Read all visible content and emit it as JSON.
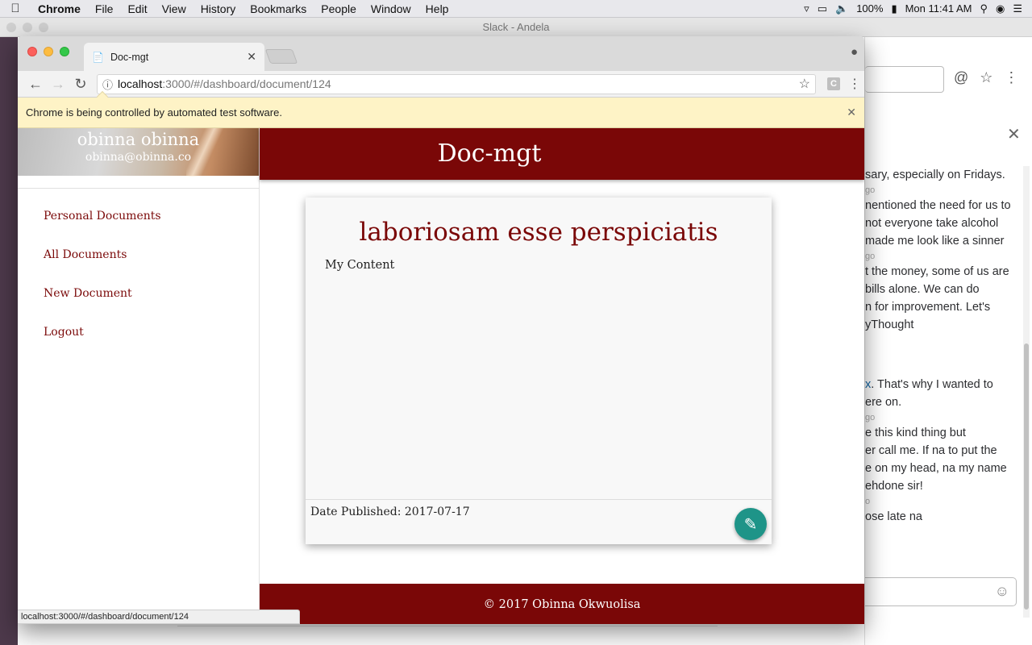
{
  "menubar": {
    "app": "Chrome",
    "items": [
      "File",
      "Edit",
      "View",
      "History",
      "Bookmarks",
      "People",
      "Window",
      "Help"
    ],
    "battery": "100%",
    "clock": "Mon 11:41 AM"
  },
  "slack": {
    "window_title": "Slack - Andela",
    "messages": [
      "sary, especially on Fridays.",
      "go",
      "nentioned the need for us to",
      "not everyone take alcohol",
      "made me look like a sinner",
      "go",
      "t the money, some of us are",
      "bills alone. We can do",
      "n for improvement. Let's",
      "yThought"
    ],
    "messages2_link": "x",
    "messages2": [
      ". That's why I wanted to",
      "ere on.",
      "go",
      "e this kind thing but",
      "er call me. If na to put the",
      "e on my head, na my name",
      "ehdone sir!",
      "o",
      "ose late na"
    ]
  },
  "browser": {
    "tab_title": "Doc-mgt",
    "url_host": "localhost",
    "url_path": ":3000/#/dashboard/document/124",
    "extension_label": "C",
    "infobar_text": "Chrome is being controlled by automated test software.",
    "status_url": "localhost:3000/#/dashboard/document/124"
  },
  "sidenav": {
    "user_name": "obinna obinna",
    "user_email": "obinna@obinna.co",
    "items": [
      "Personal Documents",
      "All Documents",
      "New Document",
      "Logout"
    ]
  },
  "header": {
    "title": "Doc-mgt"
  },
  "document": {
    "title": "laboriosam esse perspiciatis",
    "content": "My Content",
    "date_published": "Date Published: 2017-07-17"
  },
  "footer": {
    "text": "© 2017 Obinna Okwuolisa"
  },
  "colors": {
    "brand": "#7a0707",
    "fab": "#1e9488",
    "infobar": "#fef3c6"
  }
}
